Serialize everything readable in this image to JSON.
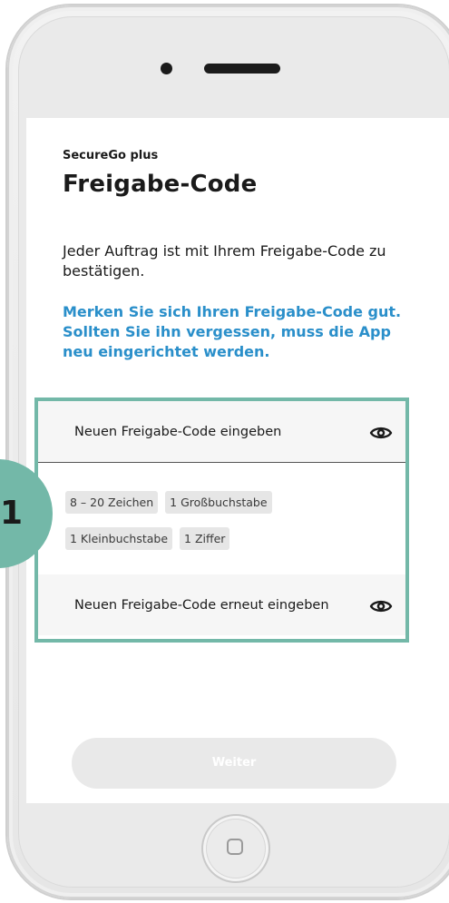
{
  "screen": {
    "brand": "SecureGo plus",
    "title": "Freigabe-Code",
    "intro": "Jeder Auftrag ist mit Ihrem Freigabe-Code zu bestätigen.",
    "warning": "Merken Sie sich Ihren Freigabe-Code gut. Sollten Sie ihn vergessen, muss die App neu eingerichtet werden."
  },
  "form": {
    "new_code_placeholder": "Neuen Freigabe-Code eingeben",
    "repeat_code_placeholder": "Neuen Freigabe-Code erneut eingeben",
    "requirements": [
      "8 – 20 Zeichen",
      "1 Großbuchstabe",
      "1 Kleinbuchstabe",
      "1 Ziffer"
    ],
    "show_password_icon": "eye-icon"
  },
  "actions": {
    "continue_label": "Weiter"
  },
  "annotation": {
    "step_number": "1"
  },
  "colors": {
    "accent_teal": "#73b8a8",
    "warning_blue": "#2a8fca",
    "disabled_button": "#e9e9e9"
  }
}
